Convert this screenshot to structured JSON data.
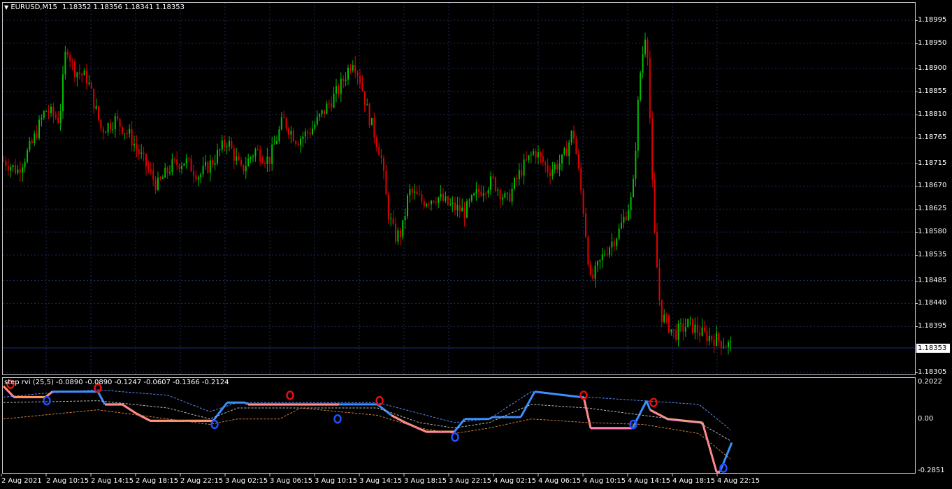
{
  "main": {
    "symbol": "EURUSD,M15",
    "ohlc": "1.18352 1.18356 1.18341 1.18353",
    "current_price": "1.18353",
    "price_ticks": [
      "1.18995",
      "1.18950",
      "1.18900",
      "1.18855",
      "1.18810",
      "1.18765",
      "1.18715",
      "1.18670",
      "1.18625",
      "1.18580",
      "1.18535",
      "1.18485",
      "1.18440",
      "1.18395",
      "1.18305"
    ]
  },
  "indicator": {
    "header": "step rvi (25,5) -0.0890 -0.0890 -0.1247 -0.0607 -0.1366 -0.2124",
    "ticks": [
      "0.2022",
      "0.00",
      "-0.2851"
    ]
  },
  "time_labels": [
    "2 Aug 2021",
    "2 Aug 10:15",
    "2 Aug 14:15",
    "2 Aug 18:15",
    "2 Aug 22:15",
    "3 Aug 02:15",
    "3 Aug 06:15",
    "3 Aug 10:15",
    "3 Aug 14:15",
    "3 Aug 18:15",
    "3 Aug 22:15",
    "4 Aug 02:15",
    "4 Aug 06:15",
    "4 Aug 10:15",
    "4 Aug 14:15",
    "4 Aug 18:15",
    "4 Aug 22:15"
  ],
  "colors": {
    "bull": "#00c000",
    "bear": "#e00000",
    "grid": "#1c2a5a",
    "ask_line": "#1a2a8a",
    "rvi_up": "#3a8fff",
    "rvi_down_a": "#ff9a5a",
    "rvi_down_b": "#ff7ac0",
    "signal": "#c040ff",
    "level_blue": "#5a8aff",
    "level_orange": "#d08040",
    "level_white": "#bbbbbb",
    "arrow_up": "#2050ff",
    "arrow_down": "#e01010"
  },
  "chart_data": [
    {
      "type": "candlestick",
      "title": "EURUSD,M15",
      "ylim": [
        1.18305,
        1.19015
      ],
      "note_series": "approximate close path (price) across the visible bars",
      "close_path": [
        [
          0,
          1.1872
        ],
        [
          20,
          1.187
        ],
        [
          40,
          1.1875
        ],
        [
          60,
          1.1882
        ],
        [
          80,
          1.188
        ],
        [
          90,
          1.1895
        ],
        [
          100,
          1.189
        ],
        [
          120,
          1.1888
        ],
        [
          140,
          1.1878
        ],
        [
          160,
          1.188
        ],
        [
          180,
          1.1877
        ],
        [
          200,
          1.1872
        ],
        [
          220,
          1.1867
        ],
        [
          240,
          1.1871
        ],
        [
          260,
          1.1872
        ],
        [
          280,
          1.1869
        ],
        [
          300,
          1.1872
        ],
        [
          320,
          1.1876
        ],
        [
          340,
          1.187
        ],
        [
          360,
          1.1874
        ],
        [
          380,
          1.1872
        ],
        [
          400,
          1.188
        ],
        [
          420,
          1.1876
        ],
        [
          440,
          1.1878
        ],
        [
          460,
          1.1882
        ],
        [
          480,
          1.1886
        ],
        [
          500,
          1.1892
        ],
        [
          510,
          1.1888
        ],
        [
          520,
          1.1882
        ],
        [
          540,
          1.1873
        ],
        [
          550,
          1.1862
        ],
        [
          560,
          1.1857
        ],
        [
          570,
          1.1858
        ],
        [
          580,
          1.1866
        ],
        [
          600,
          1.1864
        ],
        [
          620,
          1.1865
        ],
        [
          640,
          1.1863
        ],
        [
          660,
          1.1862
        ],
        [
          680,
          1.1866
        ],
        [
          700,
          1.1868
        ],
        [
          720,
          1.1864
        ],
        [
          740,
          1.187
        ],
        [
          760,
          1.1874
        ],
        [
          780,
          1.187
        ],
        [
          800,
          1.1872
        ],
        [
          815,
          1.1878
        ],
        [
          830,
          1.1862
        ],
        [
          840,
          1.1848
        ],
        [
          860,
          1.1854
        ],
        [
          880,
          1.1858
        ],
        [
          900,
          1.1865
        ],
        [
          910,
          1.1888
        ],
        [
          920,
          1.1899
        ],
        [
          930,
          1.186
        ],
        [
          940,
          1.1842
        ],
        [
          960,
          1.1838
        ],
        [
          980,
          1.184
        ],
        [
          1000,
          1.1838
        ],
        [
          1020,
          1.1837
        ],
        [
          1045,
          1.18353
        ]
      ]
    },
    {
      "type": "line",
      "title": "step rvi (25,5)",
      "ylim": [
        -0.2851,
        0.2022
      ],
      "series": [
        {
          "values": [
            -0.089,
            -0.089,
            -0.1247,
            -0.0607,
            -0.1366,
            -0.2124
          ]
        }
      ]
    }
  ]
}
